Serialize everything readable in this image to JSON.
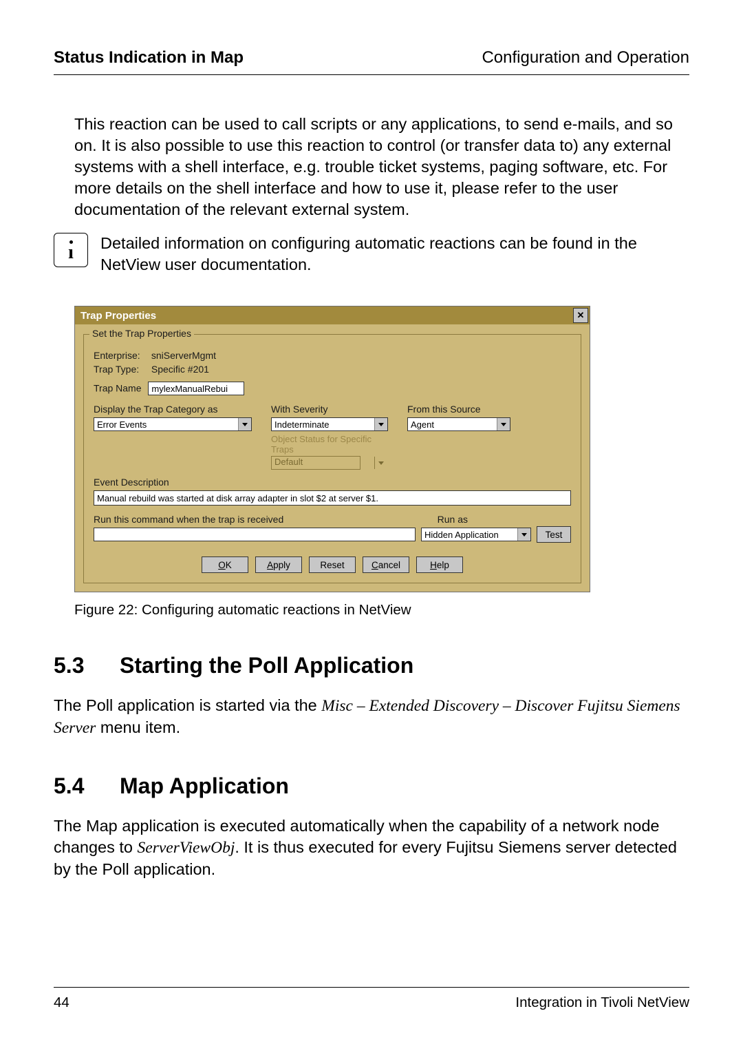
{
  "header": {
    "left": "Status Indication in Map",
    "right": "Configuration and Operation"
  },
  "paragraph1": "This reaction can be used to call scripts or any applications, to send e-mails, and so on. It is also possible to use this reaction to control (or transfer data to) any external systems with a shell interface, e.g. trouble ticket systems, paging software, etc. For more details on the shell interface and how to use it, please refer to the user documentation of the relevant external system.",
  "info_note": "Detailed information on configuring automatic reactions can be found in the NetView user documentation.",
  "dialog": {
    "title": "Trap Properties",
    "group_legend": "Set the Trap Properties",
    "enterprise_label": "Enterprise:",
    "enterprise_value": "sniServerMgmt",
    "traptype_label": "Trap Type:",
    "traptype_value": "Specific #201",
    "trapname_label": "Trap Name",
    "trapname_value": "mylexManualRebui",
    "cat_label": "Display the Trap Category as",
    "cat_value": "Error Events",
    "sev_label": "With Severity",
    "sev_value": "Indeterminate",
    "src_label": "From this Source",
    "src_value": "Agent",
    "objstat_label": "Object Status for Specific Traps",
    "objstat_value": "Default",
    "eventdesc_label": "Event Description",
    "eventdesc_value": "Manual rebuild was started at disk array adapter in slot $2 at server $1.",
    "runcmd_label": "Run this command when the trap is received",
    "runcmd_value": "",
    "runas_label": "Run as",
    "runas_value": "Hidden Application",
    "buttons": {
      "ok_u": "O",
      "ok_rest": "K",
      "apply_u": "A",
      "apply_rest": "pply",
      "reset": "Reset",
      "cancel_u": "C",
      "cancel_rest": "ancel",
      "help_u": "H",
      "help_rest": "elp",
      "test": "Test"
    }
  },
  "figure_caption": "Figure 22: Configuring automatic reactions in NetView",
  "sec53_num": "5.3",
  "sec53_title": "Starting the Poll Application",
  "sec53_body_pre": "The Poll application is started via the ",
  "sec53_body_ital": "Misc – Extended Discovery – Discover Fujitsu Siemens Server",
  "sec53_body_post": " menu item.",
  "sec54_num": "5.4",
  "sec54_title": "Map Application",
  "sec54_body_pre": "The Map application is executed automatically when the capability of a network node changes to ",
  "sec54_body_ital": "ServerViewObj",
  "sec54_body_post": ". It is thus executed for every Fujitsu Siemens server detected by the Poll application.",
  "footer": {
    "page": "44",
    "doc": "Integration in Tivoli NetView"
  }
}
